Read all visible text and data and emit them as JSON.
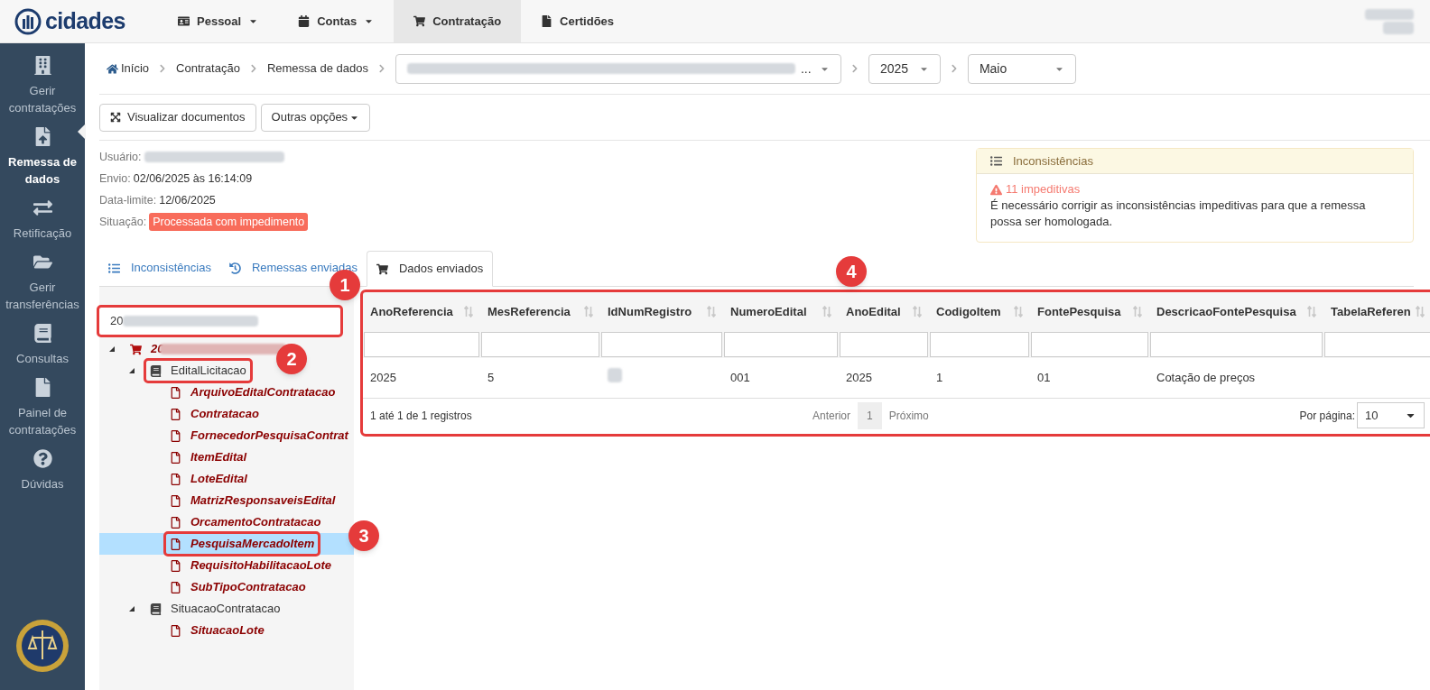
{
  "header": {
    "logo": "cidades",
    "nav": [
      {
        "label": "Pessoal",
        "dropdown": true,
        "selected": false
      },
      {
        "label": "Contas",
        "dropdown": true,
        "selected": false
      },
      {
        "label": "Contratação",
        "dropdown": false,
        "selected": true
      },
      {
        "label": "Certidões",
        "dropdown": false,
        "selected": false
      }
    ]
  },
  "sidebar": {
    "items": [
      {
        "label": "Gerir contratações",
        "selected": false
      },
      {
        "label": "Remessa de dados",
        "selected": true
      },
      {
        "label": "Retificação",
        "selected": false
      },
      {
        "label": "Gerir transferências",
        "selected": false
      },
      {
        "label": "Consultas",
        "selected": false
      },
      {
        "label": "Painel de contratações",
        "selected": false
      },
      {
        "label": "Dúvidas",
        "selected": false
      }
    ]
  },
  "breadcrumb": {
    "items": [
      "Início",
      "Contratação",
      "Remessa de dados"
    ],
    "entity_select": {
      "value": "..."
    },
    "year_select": {
      "value": "2025"
    },
    "month_select": {
      "value": "Maio"
    }
  },
  "toolbar": {
    "buttons": [
      {
        "label": "Visualizar documentos",
        "dropdown": false
      },
      {
        "label": "Outras opções",
        "dropdown": true
      }
    ]
  },
  "info": {
    "fields": [
      {
        "label": "Usuário:",
        "kind": "redacted"
      },
      {
        "label": "Envio:",
        "kind": "text",
        "value": "02/06/2025 às 16:14:09"
      },
      {
        "label": "Data-limite:",
        "kind": "text",
        "value": "12/06/2025"
      },
      {
        "label": "Situação:",
        "kind": "badge",
        "value": "Processada com impedimento"
      }
    ]
  },
  "inconsistencies_panel": {
    "title": "Inconsistências",
    "count": "11 impeditivas",
    "message": "É necessário corrigir as inconsistências impeditivas para que a remessa possa ser homologada."
  },
  "tabs": [
    {
      "label": "Inconsistências",
      "selected": false
    },
    {
      "label": "Remessas enviadas",
      "selected": false
    },
    {
      "label": "Dados enviados",
      "selected": true
    }
  ],
  "tree": {
    "search": {
      "value": "20",
      "callout": "1"
    },
    "nodes": [
      {
        "label": "20",
        "kind": "root",
        "expanded": true,
        "children": [
          {
            "label": "EditalLicitacao",
            "kind": "group",
            "expanded": true,
            "callout": "2",
            "children": [
              {
                "label": "ArquivoEditalContratacao",
                "kind": "table",
                "selected": false
              },
              {
                "label": "Contratacao",
                "kind": "table",
                "selected": false
              },
              {
                "label": "FornecedorPesquisaContrat",
                "kind": "table",
                "selected": false
              },
              {
                "label": "ItemEdital",
                "kind": "table",
                "selected": false
              },
              {
                "label": "LoteEdital",
                "kind": "table",
                "selected": false
              },
              {
                "label": "MatrizResponsaveisEdital",
                "kind": "table",
                "selected": false
              },
              {
                "label": "OrcamentoContratacao",
                "kind": "table",
                "selected": false
              },
              {
                "label": "PesquisaMercadoItem",
                "kind": "table",
                "selected": true,
                "callout": "3"
              },
              {
                "label": "RequisitoHabilitacaoLote",
                "kind": "table",
                "selected": false
              },
              {
                "label": "SubTipoContratacao",
                "kind": "table",
                "selected": false
              }
            ]
          },
          {
            "label": "SituacaoContratacao",
            "kind": "group",
            "expanded": true,
            "children": [
              {
                "label": "SituacaoLote",
                "kind": "table",
                "selected": false
              }
            ]
          }
        ]
      }
    ]
  },
  "table": {
    "callout": "4",
    "columns": [
      "AnoReferencia",
      "MesReferencia",
      "IdNumRegistro",
      "NumeroEdital",
      "AnoEdital",
      "CodigoItem",
      "FontePesquisa",
      "DescricaoFontePesquisa",
      "TabelaReferen"
    ],
    "rows": [
      [
        "2025",
        "5",
        null,
        "001",
        "2025",
        "1",
        "01",
        "Cotação de preços",
        ""
      ]
    ],
    "summary": "1 até 1 de 1 registros",
    "pagination": {
      "previous": "Anterior",
      "pages": [
        {
          "label": "1",
          "selected": true
        }
      ],
      "next": "Próximo"
    },
    "page_size": {
      "label": "Por página:",
      "value": "10"
    }
  }
}
